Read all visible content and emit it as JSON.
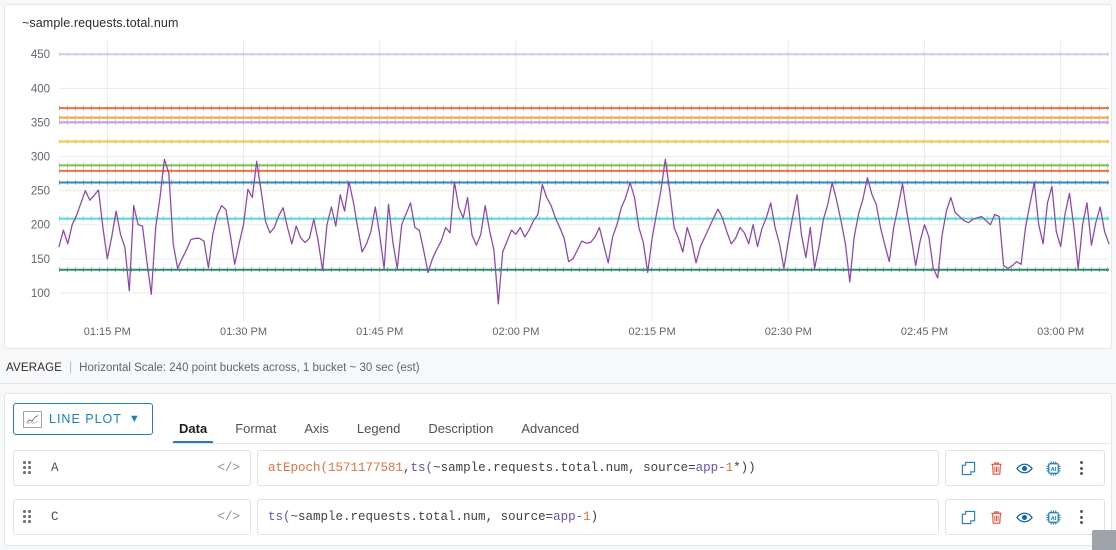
{
  "chart": {
    "title": "~sample.requests.total.num",
    "y_ticks": [
      450,
      400,
      350,
      300,
      250,
      200,
      150,
      100
    ],
    "x_ticks": [
      "01:15 PM",
      "01:30 PM",
      "01:45 PM",
      "02:00 PM",
      "02:15 PM",
      "02:30 PM",
      "02:45 PM",
      "03:00 PM"
    ]
  },
  "footer": {
    "aggregation": "AVERAGE",
    "separator": "|",
    "scale": "Horizontal Scale: 240 point buckets across, 1 bucket ~ 30 sec (est)"
  },
  "editor": {
    "plot_type": "LINE PLOT",
    "plot_type_caret": "chevron-down",
    "tabs": [
      {
        "label": "Data",
        "active": true
      },
      {
        "label": "Format",
        "active": false
      },
      {
        "label": "Axis",
        "active": false
      },
      {
        "label": "Legend",
        "active": false
      },
      {
        "label": "Description",
        "active": false
      },
      {
        "label": "Advanced",
        "active": false
      }
    ],
    "code_toggle": "</>",
    "rows": [
      {
        "name": "A",
        "expression": "atEpoch(1571177581, ts(~sample.requests.total.num, source=app-1*))",
        "tokens": [
          {
            "t": "atEpoch(",
            "c": "tk-fn"
          },
          {
            "t": "1571177581",
            "c": "tk-num"
          },
          {
            "t": ", ",
            "c": "tk-pun"
          },
          {
            "t": "ts(",
            "c": "tk-fn2"
          },
          {
            "t": "~sample.requests.total.num",
            "c": "tk-id"
          },
          {
            "t": ", source=",
            "c": "tk-pun"
          },
          {
            "t": "app-",
            "c": "tk-src"
          },
          {
            "t": "1",
            "c": "tk-num"
          },
          {
            "t": "*))",
            "c": "tk-pun"
          }
        ],
        "actions": [
          "copy-icon",
          "trash-icon",
          "eye-icon",
          "ai-chip-icon",
          "kebab-icon"
        ]
      },
      {
        "name": "C",
        "expression": "ts(~sample.requests.total.num, source=app-1)",
        "tokens": [
          {
            "t": "ts(",
            "c": "tk-fn2"
          },
          {
            "t": "~sample.requests.total.num",
            "c": "tk-id"
          },
          {
            "t": ", source=",
            "c": "tk-pun"
          },
          {
            "t": "app-",
            "c": "tk-src"
          },
          {
            "t": "1",
            "c": "tk-num"
          },
          {
            "t": ")",
            "c": "tk-pun"
          }
        ],
        "actions": [
          "copy-icon",
          "trash-icon",
          "eye-icon",
          "ai-chip-icon",
          "kebab-icon"
        ]
      }
    ]
  },
  "colors": {
    "accent": "#1d7fc0",
    "danger": "#e0513d",
    "series_line": "#8e44ad",
    "thresholds": [
      "#c9cdf0",
      "#e8703a",
      "#f0a248",
      "#c49ad8",
      "#f2c14e",
      "#7cc04a",
      "#ef7055",
      "#2f86c6",
      "#4fd6d6",
      "#2e8b6f"
    ]
  },
  "chart_data": {
    "type": "line",
    "title": "~sample.requests.total.num",
    "xlabel": "",
    "ylabel": "",
    "ylim": [
      75,
      465
    ],
    "xlim": [
      0,
      240
    ],
    "grid": true,
    "legend": "none",
    "x_tick_labels": [
      "01:15 PM",
      "01:30 PM",
      "01:45 PM",
      "02:00 PM",
      "02:15 PM",
      "02:30 PM",
      "02:45 PM",
      "03:00 PM"
    ],
    "x_tick_positions": [
      11,
      42,
      73,
      104,
      135,
      166,
      197,
      228
    ],
    "y_tick_labels": [
      450,
      400,
      350,
      300,
      250,
      200,
      150,
      100
    ],
    "threshold_lines": [
      {
        "value": 450,
        "color": "#c9cdf0"
      },
      {
        "value": 371,
        "color": "#e8703a"
      },
      {
        "value": 357,
        "color": "#f0a248"
      },
      {
        "value": 350,
        "color": "#c49ad8"
      },
      {
        "value": 322,
        "color": "#f2c14e"
      },
      {
        "value": 287,
        "color": "#7cc04a"
      },
      {
        "value": 279,
        "color": "#ef7055"
      },
      {
        "value": 262,
        "color": "#2f86c6"
      },
      {
        "value": 209,
        "color": "#4fd6d6"
      },
      {
        "value": 134,
        "color": "#2e8b6f"
      }
    ],
    "series": [
      {
        "name": "~sample.requests.total.num, source=app-1",
        "color": "#8e44ad",
        "values": [
          168,
          192,
          172,
          200,
          214,
          232,
          250,
          236,
          243,
          251,
          196,
          150,
          182,
          220,
          186,
          167,
          103,
          228,
          200,
          198,
          146,
          98,
          196,
          240,
          296,
          276,
          172,
          136,
          150,
          163,
          178,
          180,
          180,
          176,
          137,
          186,
          214,
          228,
          222,
          185,
          142,
          172,
          200,
          252,
          240,
          293,
          250,
          205,
          188,
          196,
          213,
          225,
          196,
          172,
          198,
          181,
          174,
          180,
          208,
          176,
          133,
          200,
          226,
          198,
          244,
          220,
          263,
          233,
          196,
          160,
          172,
          190,
          226,
          185,
          136,
          230,
          174,
          136,
          200,
          216,
          232,
          196,
          192,
          163,
          130,
          150,
          164,
          176,
          196,
          188,
          263,
          225,
          210,
          240,
          185,
          170,
          186,
          228,
          192,
          163,
          84,
          160,
          176,
          192,
          186,
          196,
          182,
          192,
          206,
          215,
          259,
          240,
          228,
          210,
          196,
          180,
          146,
          150,
          163,
          176,
          173,
          174,
          182,
          196,
          170,
          144,
          182,
          200,
          225,
          240,
          262,
          240,
          196,
          174,
          130,
          180,
          216,
          250,
          296,
          250,
          196,
          180,
          160,
          196,
          176,
          144,
          168,
          182,
          196,
          210,
          223,
          210,
          190,
          172,
          180,
          196,
          188,
          172,
          200,
          168,
          194,
          210,
          232,
          196,
          172,
          136,
          176,
          212,
          244,
          185,
          152,
          196,
          136,
          168,
          208,
          230,
          262,
          236,
          206,
          172,
          116,
          182,
          216,
          238,
          269,
          245,
          230,
          196,
          170,
          146,
          196,
          226,
          260,
          218,
          180,
          140,
          176,
          200,
          182,
          136,
          122,
          185,
          220,
          240,
          218,
          212,
          206,
          203,
          208,
          210,
          212,
          206,
          200,
          215,
          212,
          140,
          136,
          140,
          146,
          142,
          196,
          230,
          262,
          200,
          172,
          232,
          256,
          190,
          168,
          216,
          246,
          196,
          136,
          200,
          232,
          170,
          203,
          226,
          190,
          172
        ]
      }
    ]
  }
}
